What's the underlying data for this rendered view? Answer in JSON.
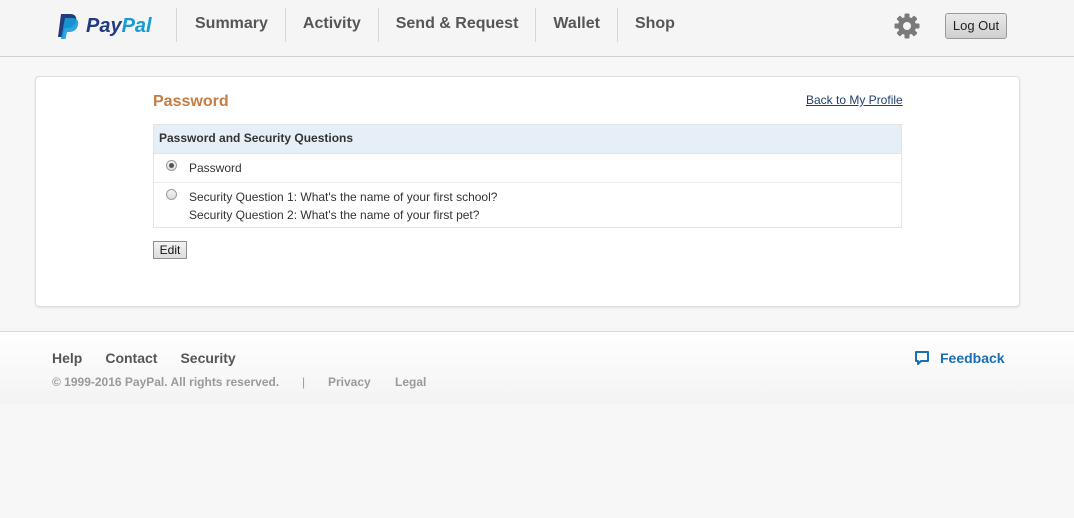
{
  "brand": {
    "name_part1": "Pay",
    "name_part2": "Pal",
    "color_dark": "#253b80",
    "color_light": "#179bd7"
  },
  "nav": {
    "items": [
      "Summary",
      "Activity",
      "Send & Request",
      "Wallet",
      "Shop"
    ],
    "settings_icon": "gear-icon",
    "logout_label": "Log Out"
  },
  "page": {
    "title": "Password",
    "back_link": "Back to My Profile",
    "section_header": "Password and Security Questions",
    "options": [
      {
        "label": "Password",
        "selected": true
      },
      {
        "lines": [
          "Security Question 1: What's the name of your first school?",
          "Security Question 2: What's the name of your first pet?"
        ],
        "selected": false
      }
    ],
    "edit_label": "Edit"
  },
  "footer": {
    "links": [
      "Help",
      "Contact",
      "Security"
    ],
    "copyright": "© 1999-2016 PayPal. All rights reserved.",
    "separator": "|",
    "privacy": "Privacy",
    "legal": "Legal",
    "feedback": "Feedback",
    "feedback_icon": "speech-bubble-icon"
  },
  "colors": {
    "title_accent": "#c77c40",
    "link": "#1a6eb3",
    "header_bg": "#e6eff8"
  }
}
